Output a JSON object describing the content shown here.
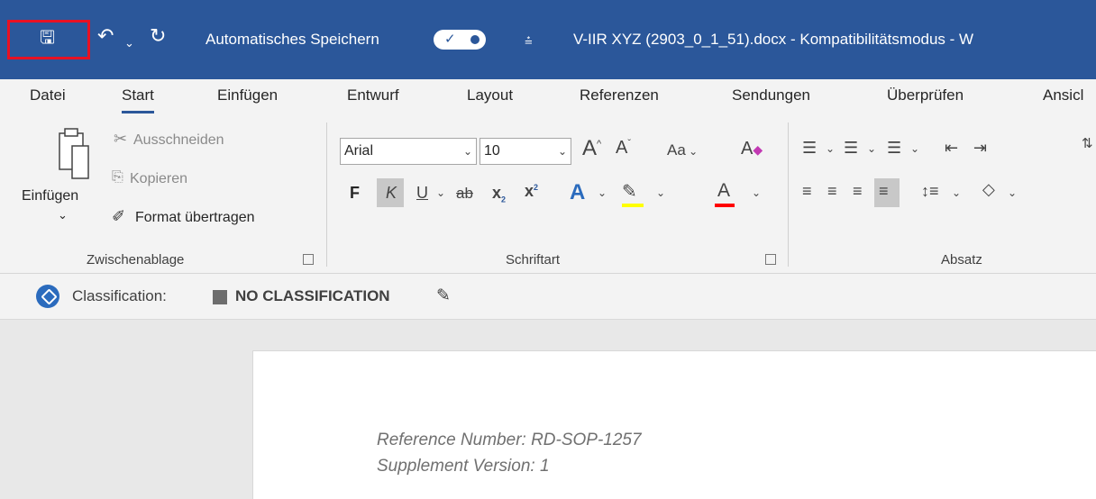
{
  "titlebar": {
    "autosave_label": "Automatisches Speichern",
    "doc_title": "V-IIR XYZ (2903_0_1_51).docx  -  Kompatibilitätsmodus  -  W"
  },
  "tabs": [
    "Datei",
    "Start",
    "Einfügen",
    "Entwurf",
    "Layout",
    "Referenzen",
    "Sendungen",
    "Überprüfen",
    "Ansicl"
  ],
  "clipboard": {
    "paste": "Einfügen",
    "cut": "Ausschneiden",
    "copy": "Kopieren",
    "format_painter": "Format übertragen",
    "group": "Zwischenablage"
  },
  "font": {
    "name": "Arial",
    "size": "10",
    "case": "Aa",
    "bold": "F",
    "italic": "K",
    "underline": "U",
    "strike": "ab",
    "group": "Schriftart"
  },
  "paragraph": {
    "group": "Absatz"
  },
  "classification": {
    "label": "Classification:",
    "value": "NO CLASSIFICATION"
  },
  "document": {
    "line1": "Reference Number: RD-SOP-1257",
    "line2": "Supplement Version: 1"
  },
  "colors": {
    "accent": "#2b579a",
    "highlight": "#ffff00",
    "font_color": "#ff0000",
    "annotation": "#e81123"
  }
}
